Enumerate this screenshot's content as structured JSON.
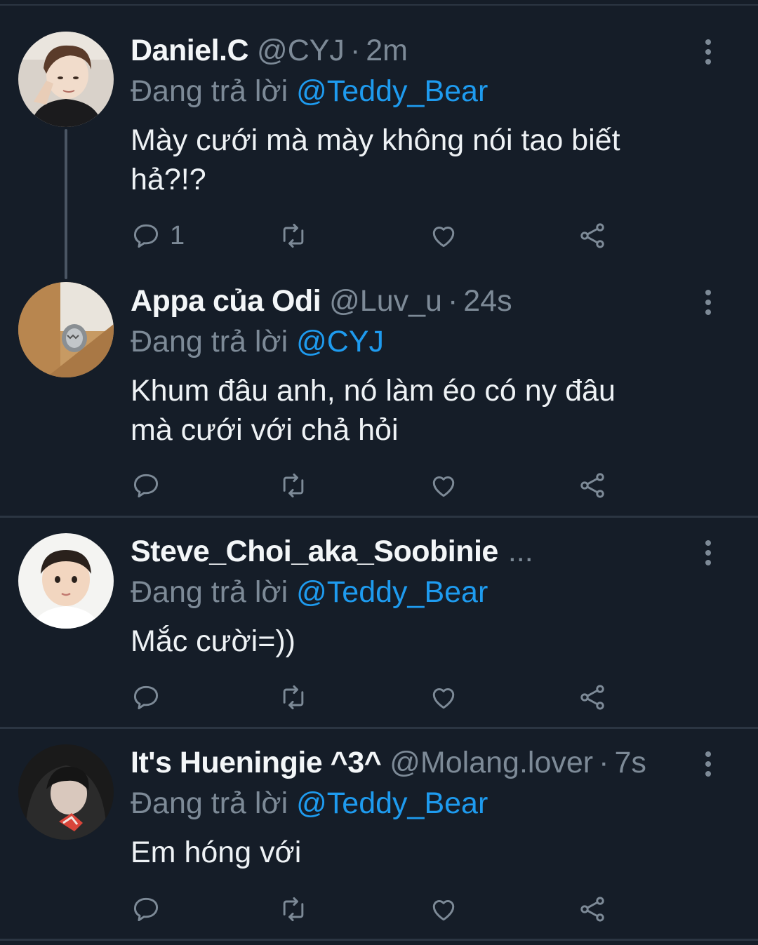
{
  "tweets": [
    {
      "name": "Daniel.C",
      "handle": "@CYJ",
      "time": "2m",
      "replying_prefix": "Đang trả lời",
      "replying_to": "@Teddy_Bear",
      "text_line1": "Mày cưới mà mày không nói tao biết",
      "text_line2": "hả?!?",
      "reply_count": "1"
    },
    {
      "name": "Appa của Odi",
      "handle": "@Luv_u",
      "time": "24s",
      "replying_prefix": "Đang trả lời",
      "replying_to": "@CYJ",
      "text_line1": "Khum đâu anh, nó làm éo có ny đâu",
      "text_line2": "mà cưới với chả hỏi",
      "reply_count": ""
    },
    {
      "name": "Steve_Choi_aka_Soobinie",
      "name_ellipsis": "...",
      "replying_prefix": "Đang trả lời",
      "replying_to": "@Teddy_Bear",
      "text_line1": "Mắc cười=))",
      "reply_count": ""
    },
    {
      "name": "It's Hueningie ^3^",
      "handle": "@Molang.lover",
      "time": "7s",
      "replying_prefix": "Đang trả lời",
      "replying_to": "@Teddy_Bear",
      "text_line1": "Em hóng với",
      "reply_count": ""
    }
  ],
  "separator": "·",
  "icons": {
    "reply": "reply-icon",
    "retweet": "retweet-icon",
    "like": "heart-icon",
    "share": "share-icon",
    "more": "more-vertical-icon"
  },
  "colors": {
    "background": "#151d28",
    "mention": "#1e9bef",
    "muted": "#7d8a97",
    "divider": "#2b3542"
  }
}
